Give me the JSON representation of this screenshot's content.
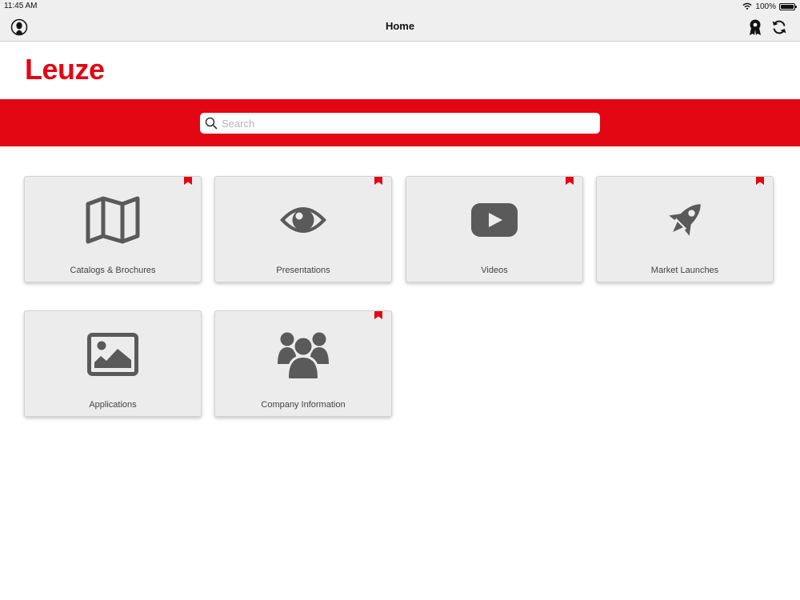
{
  "status_bar": {
    "time": "11:45 AM",
    "battery": "100%"
  },
  "nav": {
    "title": "Home"
  },
  "brand": {
    "logo_text": "Leuze",
    "accent": "#e30613"
  },
  "search": {
    "placeholder": "Search",
    "value": ""
  },
  "tiles": [
    {
      "label": "Catalogs & Brochures",
      "icon": "map-icon",
      "bookmarked": true
    },
    {
      "label": "Presentations",
      "icon": "eye-icon",
      "bookmarked": true
    },
    {
      "label": "Videos",
      "icon": "youtube-icon",
      "bookmarked": true
    },
    {
      "label": "Market Launches",
      "icon": "rocket-icon",
      "bookmarked": true
    },
    {
      "label": "Applications",
      "icon": "image-icon",
      "bookmarked": false
    },
    {
      "label": "Company Information",
      "icon": "users-icon",
      "bookmarked": true
    }
  ]
}
